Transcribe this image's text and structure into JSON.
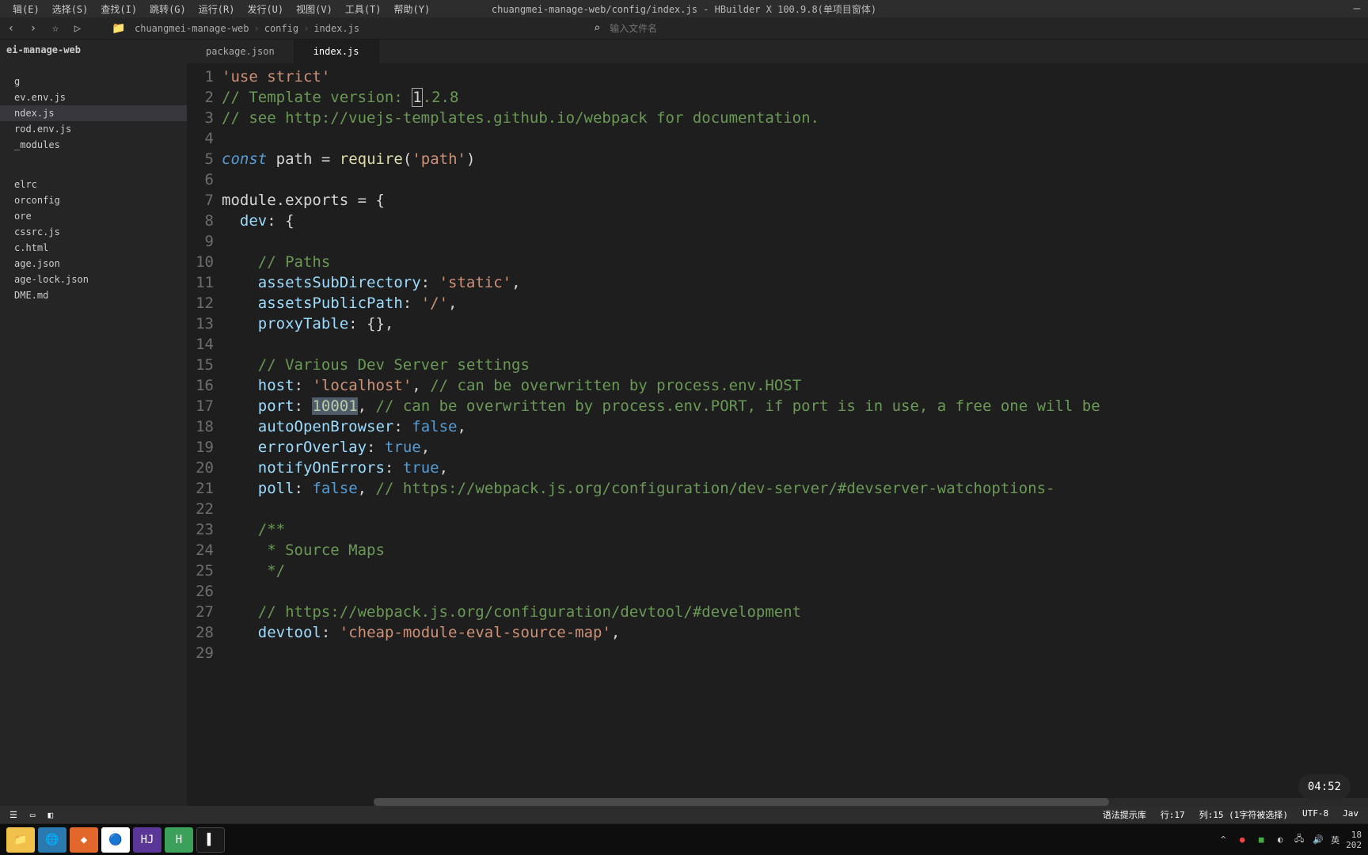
{
  "window_title": "chuangmei-manage-web/config/index.js - HBuilder X 100.9.8(单项目窗体)",
  "menu": [
    "辑(E)",
    "选择(S)",
    "查找(I)",
    "跳转(G)",
    "运行(R)",
    "发行(U)",
    "视图(V)",
    "工具(T)",
    "帮助(Y)"
  ],
  "breadcrumb": [
    "chuangmei-manage-web",
    "config",
    "index.js"
  ],
  "search_placeholder": "输入文件名",
  "sidebar": {
    "root": "ei-manage-web",
    "items_group1": [
      "g",
      "ev.env.js",
      "ndex.js",
      "rod.env.js",
      "_modules"
    ],
    "active_index": 2,
    "items_group2": [
      "elrc",
      "orconfig",
      "ore",
      "cssrc.js",
      "c.html",
      "age.json",
      "age-lock.json",
      "DME.md"
    ]
  },
  "tabs": [
    {
      "label": "package.json",
      "active": false
    },
    {
      "label": "index.js",
      "active": true
    }
  ],
  "code_lines": [
    {
      "n": 1,
      "html": "<span class='c-str'>'use strict'</span>"
    },
    {
      "n": 2,
      "html": "<span class='c-com'>// Template version: </span><span class='cursor-box'>1</span><span class='c-com'>.2.8</span>"
    },
    {
      "n": 3,
      "html": "<span class='c-com'>// see http://vuejs-templates.github.io/webpack for documentation.</span>"
    },
    {
      "n": 4,
      "html": ""
    },
    {
      "n": 5,
      "html": "<span class='c-kw'>const</span> <span class='c-var'>path</span> <span class='c-punc'>=</span> <span class='c-fn'>require</span><span class='c-punc'>(</span><span class='c-str'>'path'</span><span class='c-punc'>)</span>"
    },
    {
      "n": 6,
      "html": ""
    },
    {
      "n": 7,
      "html": "<span class='c-var'>module.exports</span> <span class='c-punc'>= {</span>"
    },
    {
      "n": 8,
      "html": "  <span class='c-prop'>dev</span><span class='c-punc'>: {</span>"
    },
    {
      "n": 9,
      "html": ""
    },
    {
      "n": 10,
      "html": "    <span class='c-com'>// Paths</span>"
    },
    {
      "n": 11,
      "html": "    <span class='c-prop'>assetsSubDirectory</span><span class='c-punc'>:</span> <span class='c-str'>'static'</span><span class='c-punc'>,</span>"
    },
    {
      "n": 12,
      "html": "    <span class='c-prop'>assetsPublicPath</span><span class='c-punc'>:</span> <span class='c-str'>'/'</span><span class='c-punc'>,</span>"
    },
    {
      "n": 13,
      "html": "    <span class='c-prop'>proxyTable</span><span class='c-punc'>: {},</span>"
    },
    {
      "n": 14,
      "html": ""
    },
    {
      "n": 15,
      "html": "    <span class='c-com'>// Various Dev Server settings</span>"
    },
    {
      "n": 16,
      "html": "    <span class='c-prop'>host</span><span class='c-punc'>:</span> <span class='c-str'>'localhost'</span><span class='c-punc'>,</span> <span class='c-com'>// can be overwritten by process.env.HOST</span>"
    },
    {
      "n": 17,
      "html": "    <span class='c-prop'>port</span><span class='c-punc'>:</span> <span class='c-sel c-num'>10001</span><span class='c-punc'>,</span> <span class='c-com'>// can be overwritten by process.env.PORT, if port is in use, a free one will be</span>"
    },
    {
      "n": 18,
      "html": "    <span class='c-prop'>autoOpenBrowser</span><span class='c-punc'>:</span> <span class='c-bool'>false</span><span class='c-punc'>,</span>"
    },
    {
      "n": 19,
      "html": "    <span class='c-prop'>errorOverlay</span><span class='c-punc'>:</span> <span class='c-bool'>true</span><span class='c-punc'>,</span>"
    },
    {
      "n": 20,
      "html": "    <span class='c-prop'>notifyOnErrors</span><span class='c-punc'>:</span> <span class='c-bool'>true</span><span class='c-punc'>,</span>"
    },
    {
      "n": 21,
      "html": "    <span class='c-prop'>poll</span><span class='c-punc'>:</span> <span class='c-bool'>false</span><span class='c-punc'>,</span> <span class='c-com'>// https://webpack.js.org/configuration/dev-server/#devserver-watchoptions-</span>"
    },
    {
      "n": 22,
      "html": ""
    },
    {
      "n": 23,
      "html": "    <span class='c-com'>/**</span>"
    },
    {
      "n": 24,
      "html": "<span class='c-com'>     * Source Maps</span>"
    },
    {
      "n": 25,
      "html": "<span class='c-com'>     */</span>"
    },
    {
      "n": 26,
      "html": ""
    },
    {
      "n": 27,
      "html": "    <span class='c-com'>// https://webpack.js.org/configuration/devtool/#development</span>"
    },
    {
      "n": 28,
      "html": "    <span class='c-prop'>devtool</span><span class='c-punc'>:</span> <span class='c-str'>'cheap-module-eval-source-map'</span><span class='c-punc'>,</span>"
    },
    {
      "n": 29,
      "html": ""
    }
  ],
  "status": {
    "syntax": "语法提示库",
    "pos": "行:17",
    "col": "列:15 (1字符被选择)",
    "encoding": "UTF-8",
    "lang": "Jav"
  },
  "overlay_time": "04:52",
  "taskbar_right": {
    "time": "18",
    "date": "202",
    "ime": "英"
  }
}
